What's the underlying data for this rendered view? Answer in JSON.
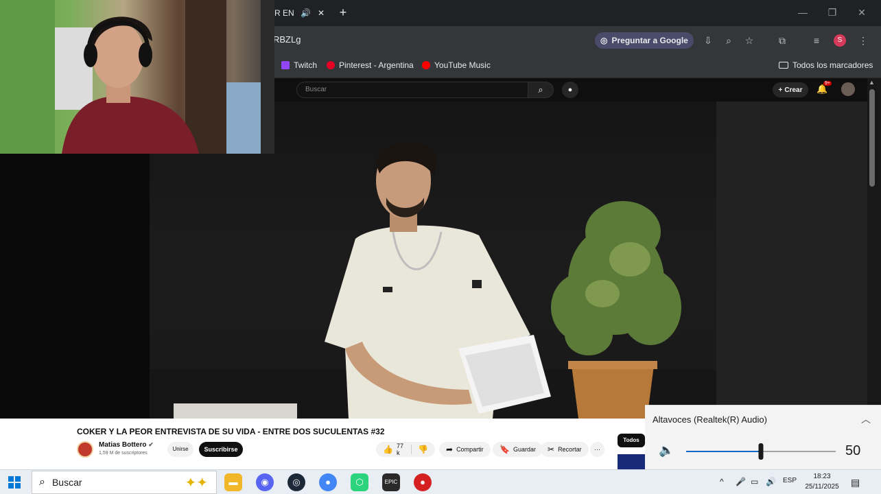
{
  "tabstrip": {
    "active_tab_title": "R ENT",
    "window_controls": [
      "minimize-icon",
      "restore-icon",
      "close-icon"
    ]
  },
  "addressbar": {
    "url": "RBZLg",
    "google_button": "Preguntar a Google"
  },
  "profile_initial": "S",
  "bookmarks": [
    {
      "label": "Twitch",
      "color": "#9146ff"
    },
    {
      "label": "Pinterest - Argentina",
      "color": "#e60023"
    },
    {
      "label": "YouTube Music",
      "color": "#ff0000"
    }
  ],
  "bookmarks_all": "Todos los marcadores",
  "youtube": {
    "search_placeholder": "Buscar",
    "create_label": "Crear",
    "notif_badge": "9+",
    "video_title": "COKER Y LA PEOR ENTREVISTA DE SU VIDA - ENTRE DOS SUCULENTAS #32",
    "channel_name": "Matias Bottero",
    "subscribers": "1,59 M de suscriptores",
    "join_label": "Unirse",
    "subscribe_label": "Suscribirse",
    "likes": "77 k",
    "share_label": "Compartir",
    "save_label": "Guardar",
    "clip_label": "Recortar",
    "more_label": "···",
    "filter_chip": "Todos"
  },
  "volume": {
    "device": "Altavoces (Realtek(R) Audio)",
    "level": 50,
    "level_text": "50"
  },
  "taskbar": {
    "search_placeholder": "Buscar",
    "apps": [
      {
        "name": "file-explorer",
        "color": "#f2b728"
      },
      {
        "name": "discord",
        "color": "#5865f2"
      },
      {
        "name": "steam",
        "color": "#1b2838"
      },
      {
        "name": "chrome",
        "color": "#4285f4"
      },
      {
        "name": "app-green",
        "color": "#2bd47c"
      },
      {
        "name": "epic-games",
        "color": "#2a2a2a"
      },
      {
        "name": "app-red-cursor",
        "color": "#d42020"
      }
    ],
    "language": "ESP",
    "time": "18:23",
    "date": "25/11/2025"
  }
}
